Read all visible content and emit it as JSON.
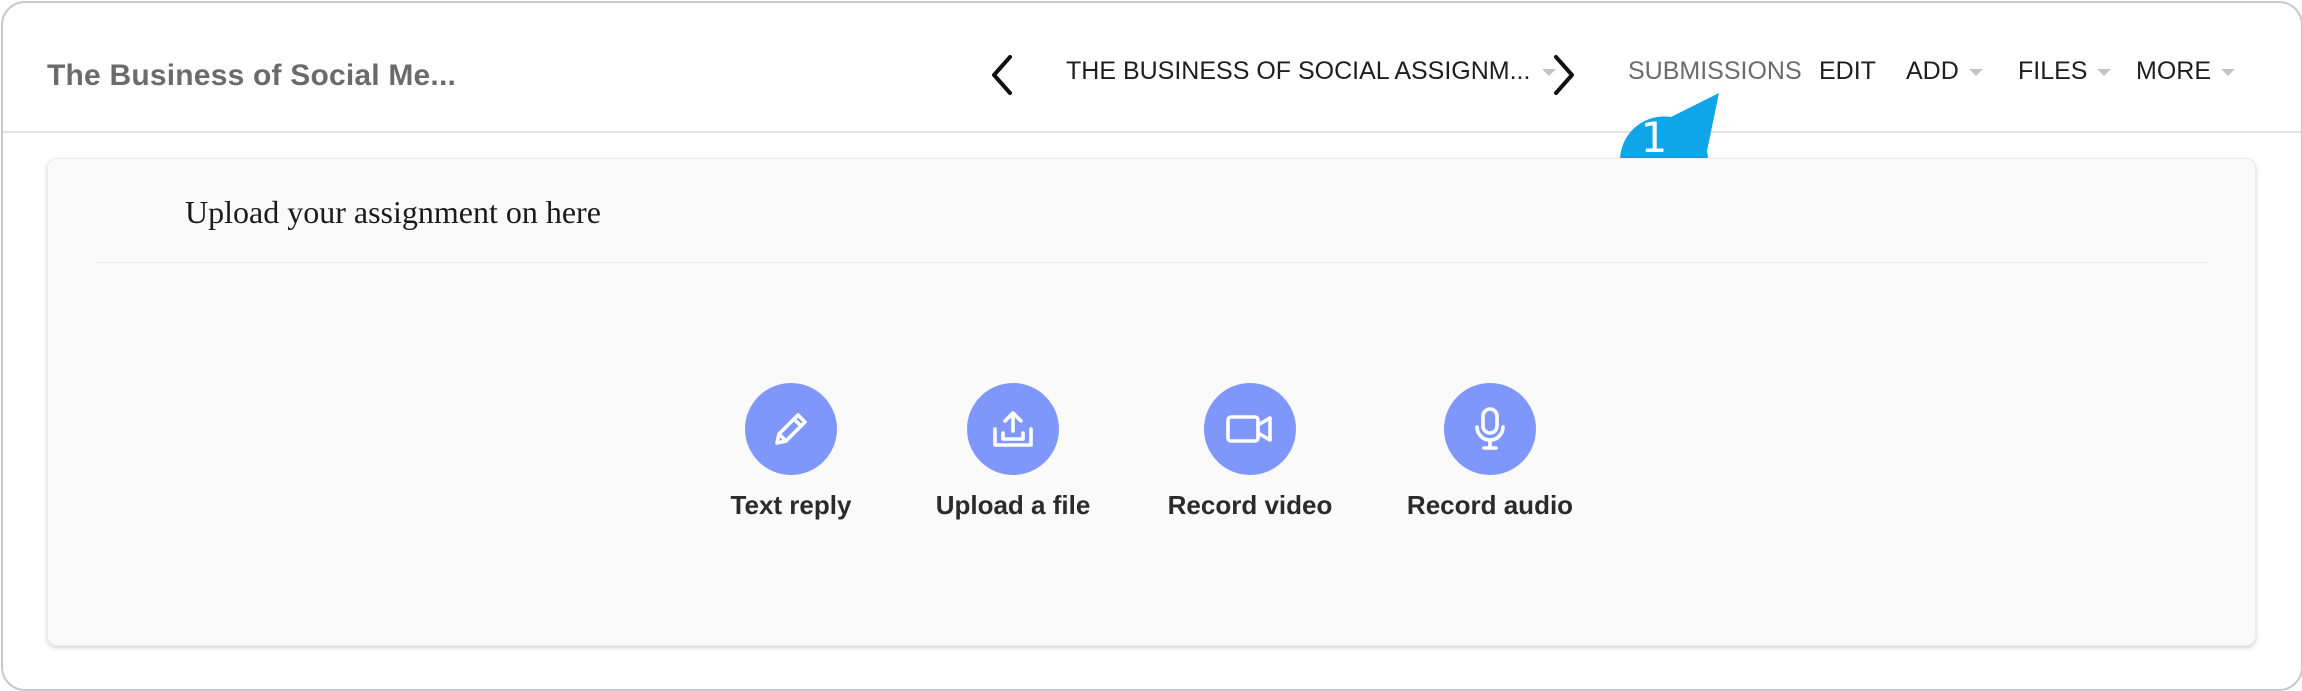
{
  "header": {
    "course_title": "The Business of Social Me...",
    "assignment_select": "THE BUSINESS OF SOCIAL ASSIGNM...",
    "menu": {
      "submissions": "SUBMISSIONS",
      "edit": "EDIT",
      "add": "ADD",
      "files": "FILES",
      "more": "MORE"
    }
  },
  "callout": {
    "number": "1",
    "color": "#0ea5e9"
  },
  "card": {
    "heading": "Upload your assignment on here",
    "actions": [
      {
        "label": "Text reply",
        "icon": "pencil-icon"
      },
      {
        "label": "Upload a file",
        "icon": "upload-tray-icon"
      },
      {
        "label": "Record video",
        "icon": "video-camera-icon"
      },
      {
        "label": "Record audio",
        "icon": "microphone-icon"
      }
    ],
    "action_color": "#7f97fb"
  }
}
